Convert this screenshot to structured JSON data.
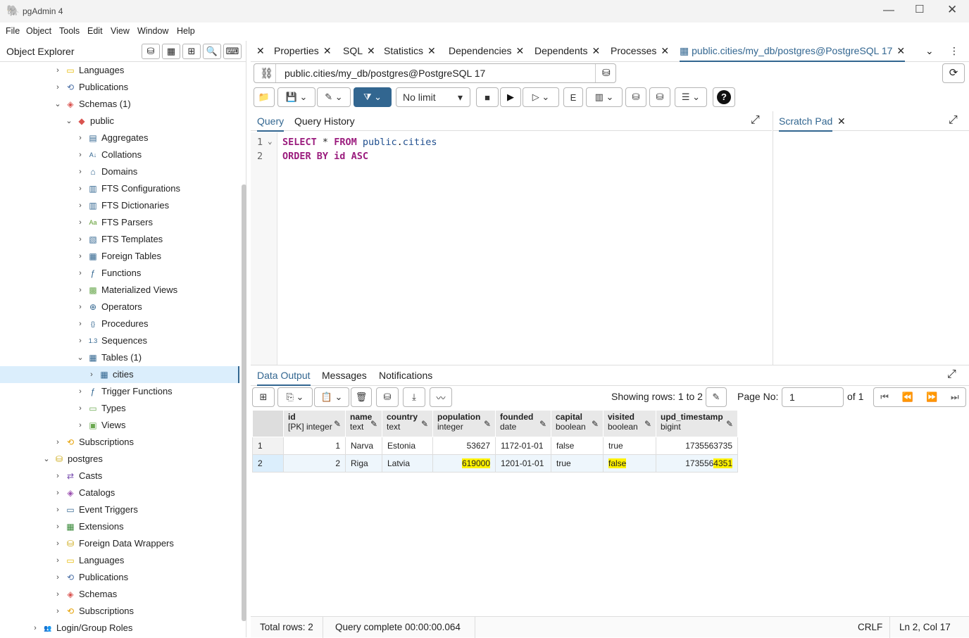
{
  "app": {
    "title": "pgAdmin 4"
  },
  "menu": [
    "File",
    "Object",
    "Tools",
    "Edit",
    "View",
    "Window",
    "Help"
  ],
  "explorer": {
    "title": "Object Explorer",
    "tree": [
      {
        "label": "Languages",
        "icon": "languages-icon"
      },
      {
        "label": "Publications",
        "icon": "publications-icon"
      },
      {
        "label": "Schemas (1)",
        "icon": "schemas-icon"
      },
      {
        "label": "public",
        "icon": "schema-icon"
      },
      {
        "label": "Aggregates",
        "icon": "aggregates-icon"
      },
      {
        "label": "Collations",
        "icon": "collations-icon"
      },
      {
        "label": "Domains",
        "icon": "domains-icon"
      },
      {
        "label": "FTS Configurations",
        "icon": "fts-configurations-icon"
      },
      {
        "label": "FTS Dictionaries",
        "icon": "fts-dictionaries-icon"
      },
      {
        "label": "FTS Parsers",
        "icon": "fts-parsers-icon"
      },
      {
        "label": "FTS Templates",
        "icon": "fts-templates-icon"
      },
      {
        "label": "Foreign Tables",
        "icon": "foreign-tables-icon"
      },
      {
        "label": "Functions",
        "icon": "functions-icon"
      },
      {
        "label": "Materialized Views",
        "icon": "materialized-views-icon"
      },
      {
        "label": "Operators",
        "icon": "operators-icon"
      },
      {
        "label": "Procedures",
        "icon": "procedures-icon"
      },
      {
        "label": "Sequences",
        "icon": "sequences-icon"
      },
      {
        "label": "Tables (1)",
        "icon": "tables-icon"
      },
      {
        "label": "cities",
        "icon": "table-icon"
      },
      {
        "label": "Trigger Functions",
        "icon": "trigger-functions-icon"
      },
      {
        "label": "Types",
        "icon": "types-icon"
      },
      {
        "label": "Views",
        "icon": "views-icon"
      },
      {
        "label": "Subscriptions",
        "icon": "subscriptions-icon"
      },
      {
        "label": "postgres",
        "icon": "database-icon"
      },
      {
        "label": "Casts",
        "icon": "casts-icon"
      },
      {
        "label": "Catalogs",
        "icon": "catalogs-icon"
      },
      {
        "label": "Event Triggers",
        "icon": "event-triggers-icon"
      },
      {
        "label": "Extensions",
        "icon": "extensions-icon"
      },
      {
        "label": "Foreign Data Wrappers",
        "icon": "foreign-data-wrappers-icon"
      },
      {
        "label": "Languages",
        "icon": "languages-icon"
      },
      {
        "label": "Publications",
        "icon": "publications-icon"
      },
      {
        "label": "Schemas",
        "icon": "schemas-icon"
      },
      {
        "label": "Subscriptions",
        "icon": "subscriptions-icon"
      },
      {
        "label": "Login/Group Roles",
        "icon": "login-roles-icon"
      }
    ]
  },
  "tabs": {
    "properties": "Properties",
    "sql": "SQL",
    "statistics": "Statistics",
    "dependencies": "Dependencies",
    "dependents": "Dependents",
    "processes": "Processes",
    "query": "public.cities/my_db/postgres@PostgreSQL 17"
  },
  "connection": "public.cities/my_db/postgres@PostgreSQL 17",
  "toolbar": {
    "limit": "No limit"
  },
  "query_tabs": {
    "query": "Query",
    "history": "Query History",
    "scratch": "Scratch Pad"
  },
  "editor": {
    "lines": [
      "1",
      "2"
    ],
    "line1": {
      "select": "SELECT",
      "star": "*",
      "from": "FROM",
      "schema": "public",
      "dot": ".",
      "table": "cities"
    },
    "line2": {
      "order": "ORDER BY",
      "col": "id",
      "dir": "ASC"
    }
  },
  "output_tabs": {
    "data": "Data Output",
    "messages": "Messages",
    "notifications": "Notifications"
  },
  "pager": {
    "showing": "Showing rows: 1 to 2",
    "page_label": "Page No:",
    "page": "1",
    "of": "of 1"
  },
  "grid": {
    "columns": [
      {
        "name": "id",
        "type": "[PK] integer"
      },
      {
        "name": "name",
        "type": "text"
      },
      {
        "name": "country",
        "type": "text"
      },
      {
        "name": "population",
        "type": "integer"
      },
      {
        "name": "founded",
        "type": "date"
      },
      {
        "name": "capital",
        "type": "boolean"
      },
      {
        "name": "visited",
        "type": "boolean"
      },
      {
        "name": "upd_timestamp",
        "type": "bigint"
      }
    ],
    "rows": [
      {
        "n": "1",
        "id": "1",
        "name": "Narva",
        "country": "Estonia",
        "population": "53627",
        "founded": "1172-01-01",
        "capital": "false",
        "visited": "true",
        "ts": "1735563735",
        "ts_a": "1735563735",
        "ts_b": ""
      },
      {
        "n": "2",
        "id": "2",
        "name": "Riga",
        "country": "Latvia",
        "population": "619000",
        "founded": "1201-01-01",
        "capital": "true",
        "visited": "false",
        "ts": "1735564351",
        "ts_a": "173556",
        "ts_b": "4351"
      }
    ]
  },
  "status": {
    "total": "Total rows: 2",
    "complete": "Query complete 00:00:00.064",
    "eol": "CRLF",
    "pos": "Ln 2, Col 17"
  }
}
